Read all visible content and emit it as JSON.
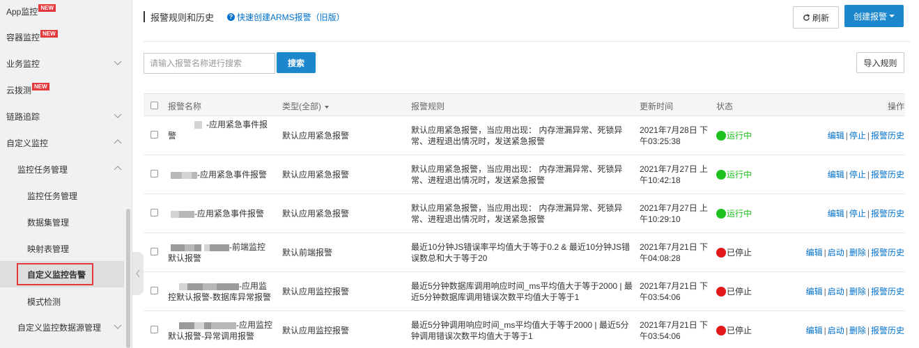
{
  "sidebar": {
    "items": [
      {
        "label": "App监控",
        "badge": "NEW"
      },
      {
        "label": "容器监控",
        "badge": "NEW"
      },
      {
        "label": "业务监控"
      },
      {
        "label": "云拨测",
        "badge": "NEW"
      },
      {
        "label": "链路追踪"
      },
      {
        "label": "自定义监控"
      },
      {
        "label": "监控任务管理"
      },
      {
        "label": "监控任务管理"
      },
      {
        "label": "数据集管理"
      },
      {
        "label": "映射表管理"
      },
      {
        "label": "自定义监控告警"
      },
      {
        "label": "模式检测"
      },
      {
        "label": "自定义监控数据源管理"
      }
    ]
  },
  "header": {
    "title": "报警规则和历史",
    "quick_link": "快速创建ARMS报警（旧版）",
    "refresh_label": "刷新",
    "create_label": "创建报警"
  },
  "toolbar": {
    "search_placeholder": "请输入报警名称进行搜索",
    "search_label": "搜索",
    "import_label": "导入规则"
  },
  "table": {
    "columns": {
      "name": "报警名称",
      "type": "类型(全部)",
      "rule": "报警规则",
      "updated": "更新时间",
      "status": "状态",
      "ops": "操作"
    },
    "rows": [
      {
        "name": "-应用紧急事件报警",
        "type": "默认应用紧急报警",
        "rule": "默认应用紧急报警，当应用出现： 内存泄漏异常、死锁异常、进程退出情况时，发送紧急报警",
        "time": "2021年7月28日 下午03:25:38",
        "status": "运行中",
        "ops": [
          "编辑",
          "停止",
          "报警历史"
        ]
      },
      {
        "name": "-应用紧急事件报警",
        "type": "默认应用紧急报警",
        "rule": "默认应用紧急报警，当应用出现： 内存泄漏异常、死锁异常、进程退出情况时，发送紧急报警",
        "time": "2021年7月27日 上午10:42:18",
        "status": "运行中",
        "ops": [
          "编辑",
          "停止",
          "报警历史"
        ]
      },
      {
        "name": "-应用紧急事件报警",
        "type": "默认应用紧急报警",
        "rule": "默认应用紧急报警，当应用出现： 内存泄漏异常、死锁异常、进程退出情况时，发送紧急报警",
        "time": "2021年7月27日 上午10:29:10",
        "status": "运行中",
        "ops": [
          "编辑",
          "停止",
          "报警历史"
        ]
      },
      {
        "name": "-前端监控默认报警",
        "type": "默认前端报警",
        "rule": "最近10分钟JS错误率平均值大于等于0.2 & 最近10分钟JS错误数总和大于等于20",
        "time": "2021年7月21日 下午04:08:28",
        "status": "已停止",
        "ops": [
          "编辑",
          "启动",
          "删除",
          "报警历史"
        ]
      },
      {
        "name": "-应用监控默认报警-数据库异常报警",
        "type": "默认应用监控报警",
        "rule": "最近5分钟数据库调用响应时间_ms平均值大于等于2000 | 最近5分钟数据库调用错误次数平均值大于等于1",
        "time": "2021年7月21日 下午03:54:06",
        "status": "已停止",
        "ops": [
          "编辑",
          "启动",
          "删除",
          "报警历史"
        ]
      },
      {
        "name": "-应用监控默认报警-异常调用报警",
        "type": "默认应用监控报警",
        "rule": "最近5分钟调用响应时间_ms平均值大于等于2000 | 最近5分钟调用错误次数平均值大于等于1",
        "time": "2021年7月21日 下午03:54:06",
        "status": "已停止",
        "ops": [
          "编辑",
          "启动",
          "删除",
          "报警历史"
        ]
      }
    ]
  }
}
